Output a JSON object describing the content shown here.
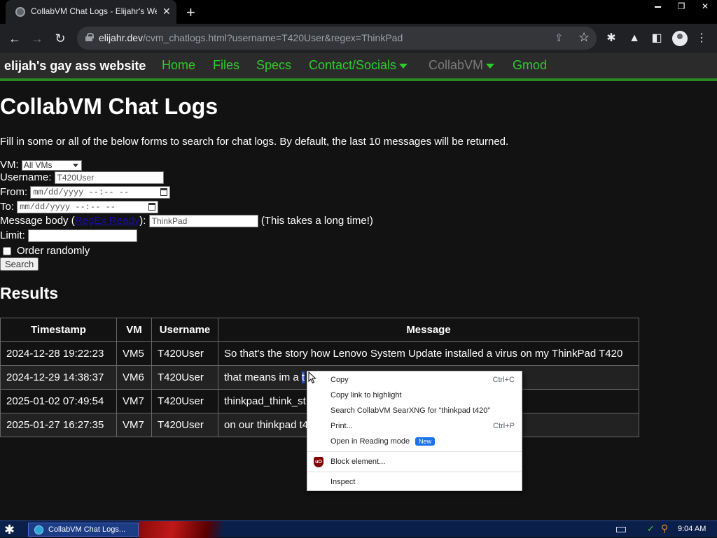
{
  "browser": {
    "tab_title": "CollabVM Chat Logs - Elijahr's Website",
    "tab_close": "✕",
    "new_tab": "+",
    "url_host": "elijahr.dev",
    "url_path": "/cvm_chatlogs.html?username=T420User&regex=ThinkPad",
    "window_controls": [
      "minimize",
      "restore",
      "close"
    ]
  },
  "site": {
    "brand": "elijah's gay ass website",
    "nav": [
      {
        "label": "Home"
      },
      {
        "label": "Files"
      },
      {
        "label": "Specs"
      },
      {
        "label": "Contact/Socials"
      },
      {
        "label": "CollabVM"
      },
      {
        "label": "Gmod"
      }
    ]
  },
  "main": {
    "title": "CollabVM Chat Logs",
    "intro": "Fill in some or all of the below forms to search for chat logs. By default, the last 10 messages will be returned.",
    "form": {
      "vm_label": "VM:",
      "vm_value": "All VMs",
      "username_label": "Username:",
      "username_value": "T420User",
      "from_label": "From:",
      "from_placeholder": "mm/dd/yyyy --:-- --",
      "to_label": "To:",
      "to_placeholder": "mm/dd/yyyy --:-- --",
      "message_label_pre": "Message body (",
      "message_link": "RegEx Ready",
      "message_label_post": "):",
      "message_value": "ThinkPad",
      "message_note": "(This takes a long time!)",
      "limit_label": "Limit:",
      "limit_value": "",
      "random_label": "Order randomly",
      "search_button": "Search"
    },
    "results_title": "Results",
    "table": {
      "headers": [
        "Timestamp",
        "VM",
        "Username",
        "Message"
      ],
      "rows": [
        [
          "2024-12-28 19:22:23",
          "VM5",
          "T420User",
          "So that's the story how Lenovo System Update installed a virus on my ThinkPad T420"
        ],
        [
          "2024-12-29 14:38:37",
          "VM6",
          "T420User",
          "that means im a t"
        ],
        [
          "2025-01-02 07:49:54",
          "VM7",
          "T420User",
          "thinkpad_think_st"
        ],
        [
          "2025-01-27 16:27:35",
          "VM7",
          "T420User",
          "on our thinkpad t4"
        ]
      ]
    }
  },
  "context_menu": {
    "items": [
      {
        "label": "Copy",
        "shortcut": "Ctrl+C"
      },
      {
        "label": "Copy link to highlight",
        "shortcut": ""
      },
      {
        "label": "Search CollabVM SearXNG for “thinkpad t420”",
        "shortcut": ""
      },
      {
        "label": "Print...",
        "shortcut": "Ctrl+P"
      },
      {
        "label": "Open in Reading mode",
        "shortcut": "",
        "badge": "New"
      },
      {
        "label": "Block element...",
        "shortcut": "",
        "icon": "ublock-origin-icon"
      },
      {
        "label": "Inspect",
        "shortcut": ""
      }
    ]
  },
  "taskbar": {
    "task_label": "CollabVM Chat Logs...",
    "clock": "9:04 AM"
  }
}
